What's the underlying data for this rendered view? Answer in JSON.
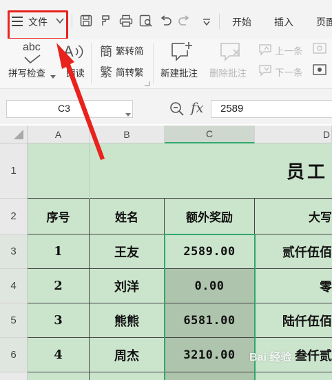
{
  "toolbar": {
    "file_label": "文件",
    "tabs": [
      "开始",
      "插入",
      "页面"
    ]
  },
  "ribbon": {
    "spellcheck": "拼写检查",
    "read": "朗读",
    "trad_to_simp": "繁转简",
    "simp_to_trad": "简转繁",
    "new_comment": "新建批注",
    "delete_comment": "删除批注",
    "prev_item": "上一条",
    "next_item": "下一条",
    "abc": "abc"
  },
  "formula_bar": {
    "cell_ref": "C3",
    "fx": "fx",
    "value": "2589"
  },
  "sheet": {
    "columns": [
      "A",
      "B",
      "C",
      "D"
    ],
    "rows": [
      "1",
      "2",
      "3",
      "4",
      "5",
      "6"
    ],
    "title": "员工",
    "headers": [
      "序号",
      "姓名",
      "额外奖励",
      "大写"
    ],
    "data": [
      {
        "no": "1",
        "name": "王友",
        "bonus": "2589.00",
        "upper": "贰仟伍佰"
      },
      {
        "no": "2",
        "name": "刘洋",
        "bonus": "0.00",
        "upper": "零"
      },
      {
        "no": "3",
        "name": "熊熊",
        "bonus": "6581.00",
        "upper": "陆仟伍佰"
      },
      {
        "no": "4",
        "name": "周杰",
        "bonus": "3210.00",
        "upper": "叁仟贰"
      }
    ]
  },
  "colors": {
    "cell_green": "#cbe4cc",
    "selection_green": "#2fa86c",
    "annotation_red": "#e8231d"
  },
  "watermark": "Bai 经验"
}
